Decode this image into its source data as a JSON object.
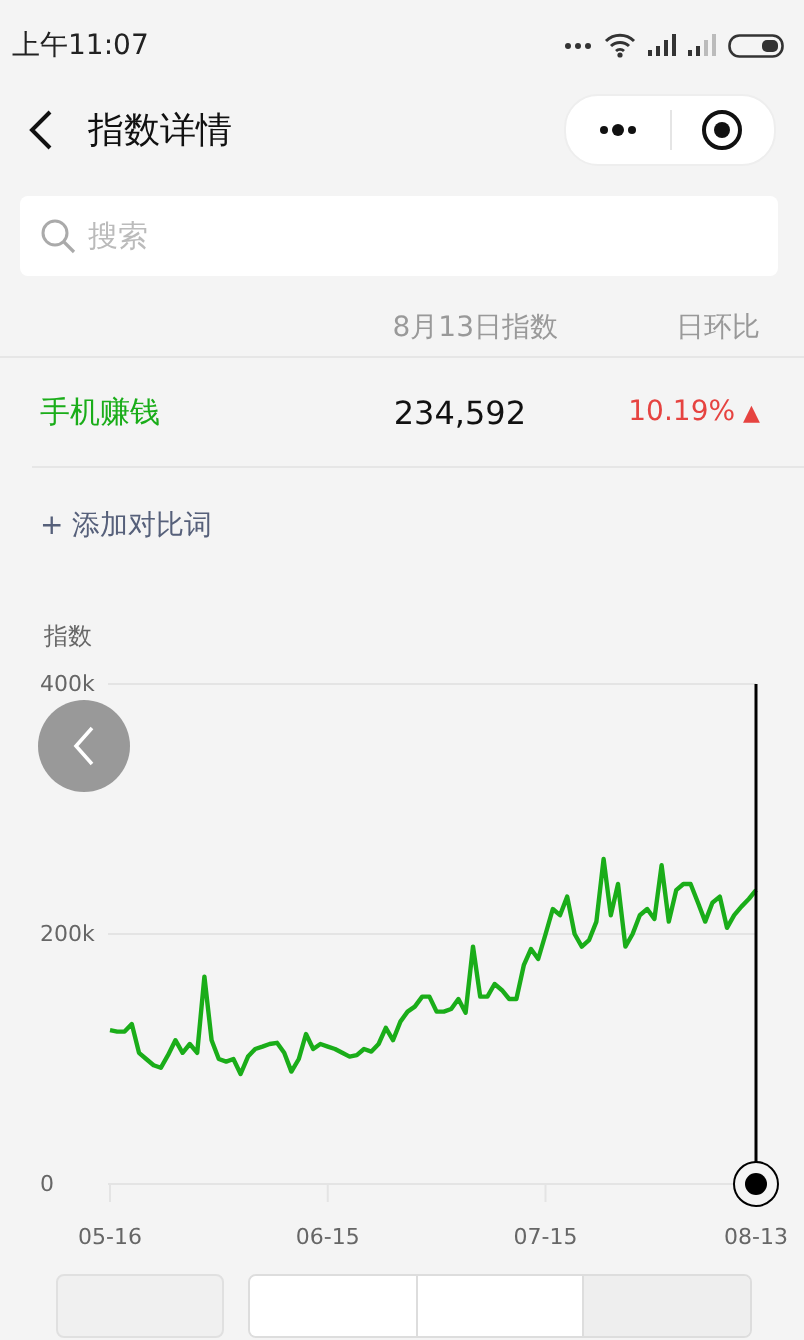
{
  "status_bar": {
    "time": "上午11:07"
  },
  "nav": {
    "title": "指数详情"
  },
  "search": {
    "placeholder": "搜索"
  },
  "table": {
    "columns": [
      "8月13日指数",
      "日环比"
    ],
    "rows": [
      {
        "keyword": "手机赚钱",
        "value": "234,592",
        "change": "10.19%",
        "arrow": "▲"
      }
    ]
  },
  "add_compare": "+ 添加对比词",
  "chart": {
    "chart_data": {
      "type": "line",
      "ylabel": "指数",
      "categories": [
        "05-16",
        null,
        null,
        null,
        null,
        null,
        null,
        null,
        null,
        null,
        null,
        null,
        null,
        null,
        null,
        null,
        null,
        null,
        null,
        null,
        null,
        null,
        null,
        null,
        null,
        null,
        null,
        null,
        null,
        null,
        "06-15",
        null,
        null,
        null,
        null,
        null,
        null,
        null,
        null,
        null,
        null,
        null,
        null,
        null,
        null,
        null,
        null,
        null,
        null,
        null,
        null,
        null,
        null,
        null,
        null,
        null,
        null,
        null,
        null,
        null,
        "07-15",
        null,
        null,
        null,
        null,
        null,
        null,
        null,
        null,
        null,
        null,
        null,
        null,
        null,
        null,
        null,
        null,
        null,
        null,
        null,
        null,
        null,
        null,
        null,
        null,
        null,
        null,
        null,
        null,
        "08-13"
      ],
      "series": [
        {
          "color": "#1aad19",
          "values": [
            123000,
            122000,
            122000,
            128000,
            105000,
            100000,
            95000,
            93000,
            103000,
            115000,
            105000,
            112000,
            105000,
            166000,
            115000,
            100000,
            98000,
            100000,
            88000,
            102000,
            108000,
            110000,
            112000,
            113000,
            105000,
            90000,
            100000,
            120000,
            108000,
            112000,
            110000,
            108000,
            105000,
            102000,
            103000,
            108000,
            106000,
            112000,
            125000,
            115000,
            130000,
            138000,
            142000,
            150000,
            150000,
            138000,
            138000,
            140000,
            148000,
            137000,
            190000,
            150000,
            150000,
            160000,
            155000,
            148000,
            148000,
            175000,
            188000,
            180000,
            200000,
            220000,
            215000,
            230000,
            200000,
            190000,
            195000,
            210000,
            260000,
            215000,
            240000,
            190000,
            200000,
            215000,
            220000,
            212000,
            255000,
            210000,
            235000,
            240000,
            240000,
            225000,
            210000,
            225000,
            230000,
            205000,
            215000,
            222000,
            228000,
            235000
          ]
        }
      ],
      "ylim": [
        0,
        400000
      ],
      "yticks": [
        {
          "value": 0,
          "label": "0"
        },
        {
          "value": 200000,
          "label": "200k"
        },
        {
          "value": 400000,
          "label": "400k"
        }
      ]
    }
  }
}
